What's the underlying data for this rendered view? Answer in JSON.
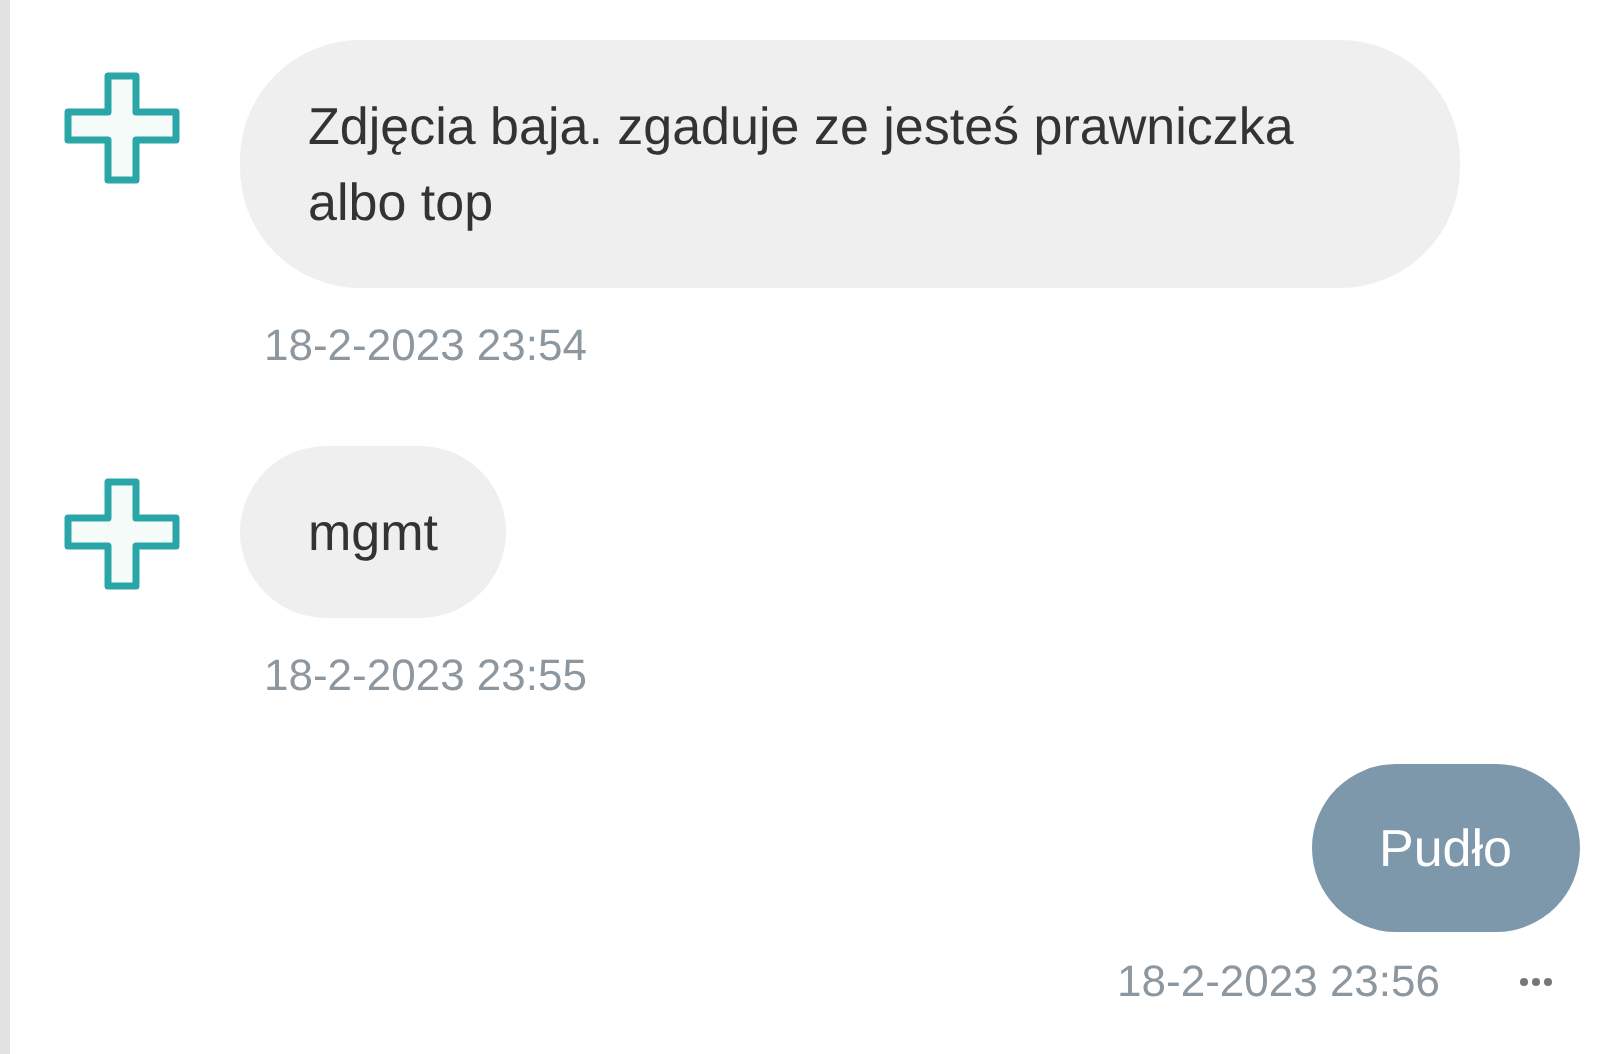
{
  "messages": [
    {
      "kind": "incoming",
      "text": "Zdjęcia baja. zgaduje ze jesteś prawniczka albo top",
      "time": "18-2-2023 23:54"
    },
    {
      "kind": "incoming",
      "text": "mgmt",
      "time": "18-2-2023 23:55"
    },
    {
      "kind": "outgoing",
      "text": "Pudło",
      "time": "18-2-2023 23:56"
    }
  ]
}
